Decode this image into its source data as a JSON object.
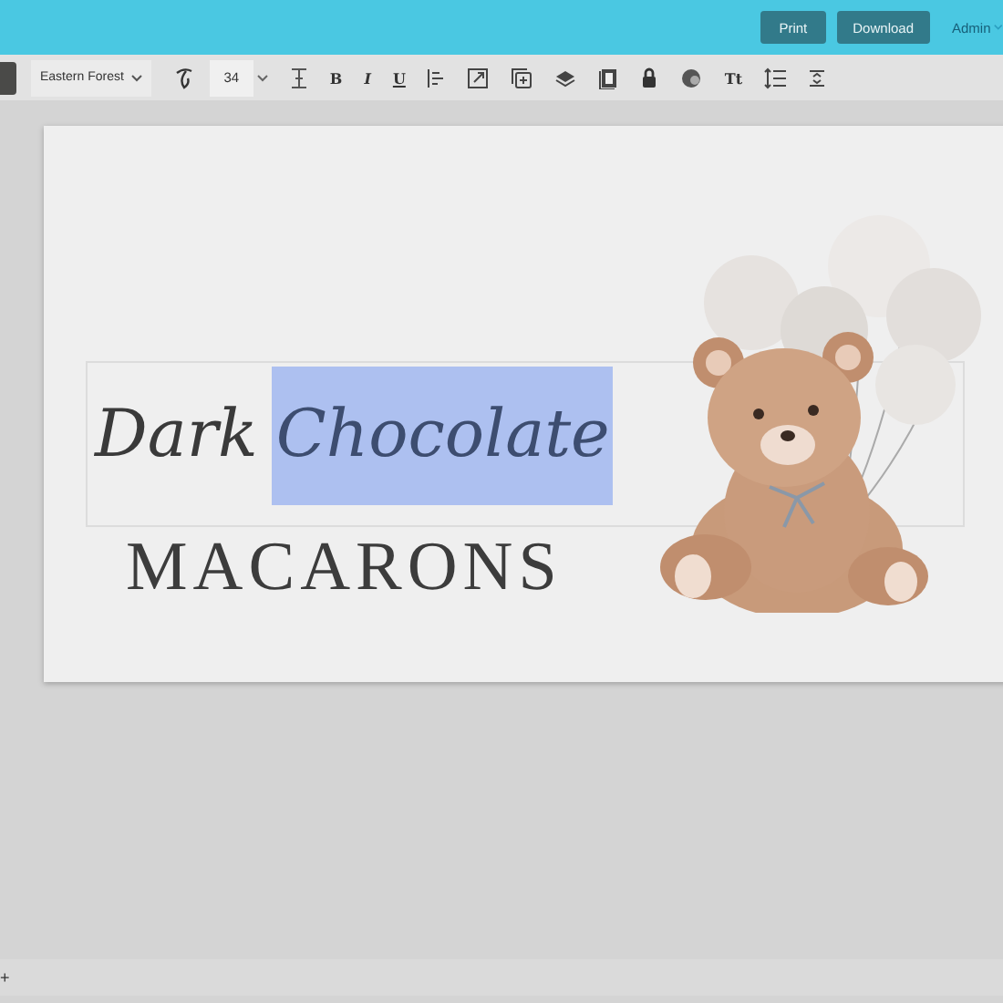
{
  "header": {
    "buttons": [
      "Print",
      "Download"
    ],
    "user_menu": "Admin"
  },
  "toolbar": {
    "font": "Eastern Forest",
    "font_size": "34",
    "tools": [
      {
        "kind": "script"
      },
      {
        "kind": "height"
      },
      {
        "kind": "glyph",
        "label": "B"
      },
      {
        "kind": "glyph",
        "label": "I"
      },
      {
        "kind": "glyph",
        "label": "U"
      },
      {
        "kind": "align"
      },
      {
        "kind": "resize"
      },
      {
        "kind": "duplicate"
      },
      {
        "kind": "layers"
      },
      {
        "kind": "page"
      },
      {
        "kind": "lock"
      },
      {
        "kind": "color"
      },
      {
        "kind": "glyph",
        "label": "Tt"
      },
      {
        "kind": "spacing"
      },
      {
        "kind": "vspace"
      }
    ]
  },
  "canvas": {
    "words": [
      {
        "text": "Dark",
        "selected": false
      },
      {
        "text": "Chocolate",
        "selected": true
      }
    ],
    "subtitle": "MACARONS"
  },
  "bottom_bar": {
    "zoom_button": "+"
  }
}
